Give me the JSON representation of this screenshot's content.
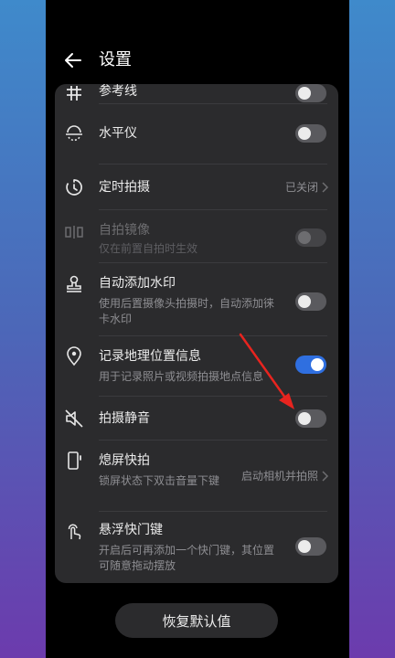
{
  "header": {
    "title": "设置"
  },
  "settings": [
    {
      "label": "参考线",
      "icon": "grid-icon",
      "control": "toggle",
      "state": "off"
    },
    {
      "label": "水平仪",
      "icon": "level-icon",
      "control": "toggle",
      "state": "off"
    },
    {
      "label": "定时拍摄",
      "icon": "timer-icon",
      "control": "value",
      "value": "已关闭"
    },
    {
      "label": "自拍镜像",
      "sub": "仅在前置自拍时生效",
      "icon": "mirror-icon",
      "control": "toggle",
      "state": "disabled"
    },
    {
      "label": "自动添加水印",
      "sub": "使用后置摄像头拍摄时，自动添加徕卡水印",
      "icon": "stamp-icon",
      "control": "toggle",
      "state": "off"
    },
    {
      "label": "记录地理位置信息",
      "sub": "用于记录照片或视频拍摄地点信息",
      "icon": "location-icon",
      "control": "toggle",
      "state": "on"
    },
    {
      "label": "拍摄静音",
      "icon": "mute-icon",
      "control": "toggle",
      "state": "off"
    },
    {
      "label": "熄屏快拍",
      "sub": "锁屏状态下双击音量下键",
      "icon": "phone-icon",
      "control": "value",
      "value": "启动相机并拍照"
    },
    {
      "label": "悬浮快门键",
      "sub": "开启后可再添加一个快门键，其位置可随意拖动摆放",
      "icon": "touch-icon",
      "control": "toggle",
      "state": "off"
    }
  ],
  "footer": {
    "reset_label": "恢复默认值"
  },
  "colors": {
    "accent": "#2f6fe0",
    "annotation": "#e8241f",
    "card": "#2b2b2d"
  }
}
